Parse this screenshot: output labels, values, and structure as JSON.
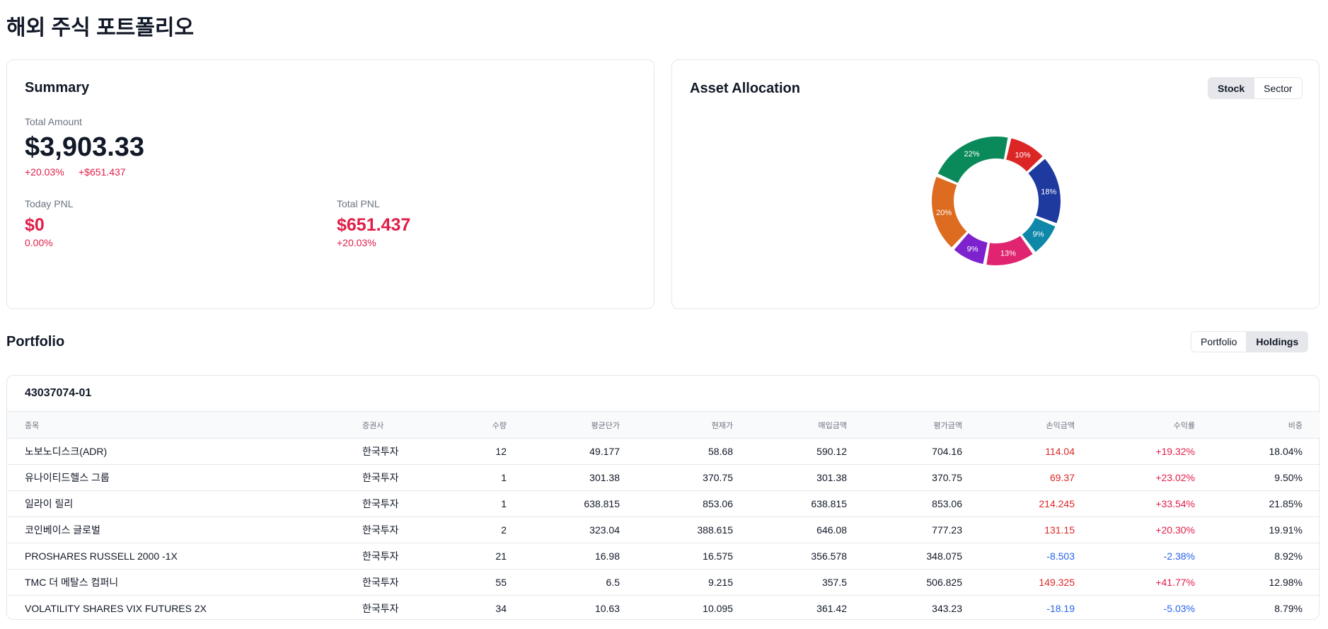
{
  "page_title": "해외 주식 포트폴리오",
  "summary": {
    "title": "Summary",
    "total_label": "Total Amount",
    "total_amount": "$3,903.33",
    "total_pct": "+20.03%",
    "total_change": "+$651.437",
    "today_label": "Today PNL",
    "today_value": "$0",
    "today_pct": "0.00%",
    "total_pnl_label": "Total PNL",
    "total_pnl_value": "$651.437",
    "total_pnl_pct": "+20.03%"
  },
  "allocation": {
    "title": "Asset Allocation",
    "toggle": [
      {
        "label": "Stock",
        "active": true
      },
      {
        "label": "Sector",
        "active": false
      }
    ],
    "slices": [
      {
        "label": "10%",
        "value": 10,
        "color": "#dc2626"
      },
      {
        "label": "18%",
        "value": 18,
        "color": "#1e3a9f"
      },
      {
        "label": "9%",
        "value": 9,
        "color": "#0e87a8"
      },
      {
        "label": "13%",
        "value": 13,
        "color": "#e0246f"
      },
      {
        "label": "9%",
        "value": 9,
        "color": "#7e22ce"
      },
      {
        "label": "20%",
        "value": 20,
        "color": "#dd6b20"
      },
      {
        "label": "22%",
        "value": 22,
        "color": "#0a8a5a"
      }
    ]
  },
  "portfolio": {
    "title": "Portfolio",
    "toggle": [
      {
        "label": "Portfolio",
        "active": false
      },
      {
        "label": "Holdings",
        "active": true
      }
    ],
    "account": "43037074-01",
    "columns": [
      "종목",
      "증권사",
      "수량",
      "평균단가",
      "현재가",
      "매입금액",
      "평가금액",
      "손익금액",
      "수익률",
      "비중"
    ],
    "rows": [
      {
        "name": "노보노디스크(ADR)",
        "broker": "한국투자",
        "qty": "12",
        "avg": "49.177",
        "cur": "58.68",
        "buy": "590.12",
        "eval": "704.16",
        "pnl": "114.04",
        "ret": "+19.32%",
        "weight": "18.04%",
        "sign": "pos"
      },
      {
        "name": "유나이티드헬스 그룹",
        "broker": "한국투자",
        "qty": "1",
        "avg": "301.38",
        "cur": "370.75",
        "buy": "301.38",
        "eval": "370.75",
        "pnl": "69.37",
        "ret": "+23.02%",
        "weight": "9.50%",
        "sign": "pos"
      },
      {
        "name": "일라이 릴리",
        "broker": "한국투자",
        "qty": "1",
        "avg": "638.815",
        "cur": "853.06",
        "buy": "638.815",
        "eval": "853.06",
        "pnl": "214.245",
        "ret": "+33.54%",
        "weight": "21.85%",
        "sign": "pos"
      },
      {
        "name": "코인베이스 글로벌",
        "broker": "한국투자",
        "qty": "2",
        "avg": "323.04",
        "cur": "388.615",
        "buy": "646.08",
        "eval": "777.23",
        "pnl": "131.15",
        "ret": "+20.30%",
        "weight": "19.91%",
        "sign": "pos"
      },
      {
        "name": "PROSHARES RUSSELL 2000 -1X",
        "broker": "한국투자",
        "qty": "21",
        "avg": "16.98",
        "cur": "16.575",
        "buy": "356.578",
        "eval": "348.075",
        "pnl": "-8.503",
        "ret": "-2.38%",
        "weight": "8.92%",
        "sign": "neg"
      },
      {
        "name": "TMC 더 메탈스 컴퍼니",
        "broker": "한국투자",
        "qty": "55",
        "avg": "6.5",
        "cur": "9.215",
        "buy": "357.5",
        "eval": "506.825",
        "pnl": "149.325",
        "ret": "+41.77%",
        "weight": "12.98%",
        "sign": "pos"
      },
      {
        "name": "VOLATILITY SHARES VIX FUTURES 2X",
        "broker": "한국투자",
        "qty": "34",
        "avg": "10.63",
        "cur": "10.095",
        "buy": "361.42",
        "eval": "343.23",
        "pnl": "-18.19",
        "ret": "-5.03%",
        "weight": "8.79%",
        "sign": "neg"
      }
    ]
  }
}
